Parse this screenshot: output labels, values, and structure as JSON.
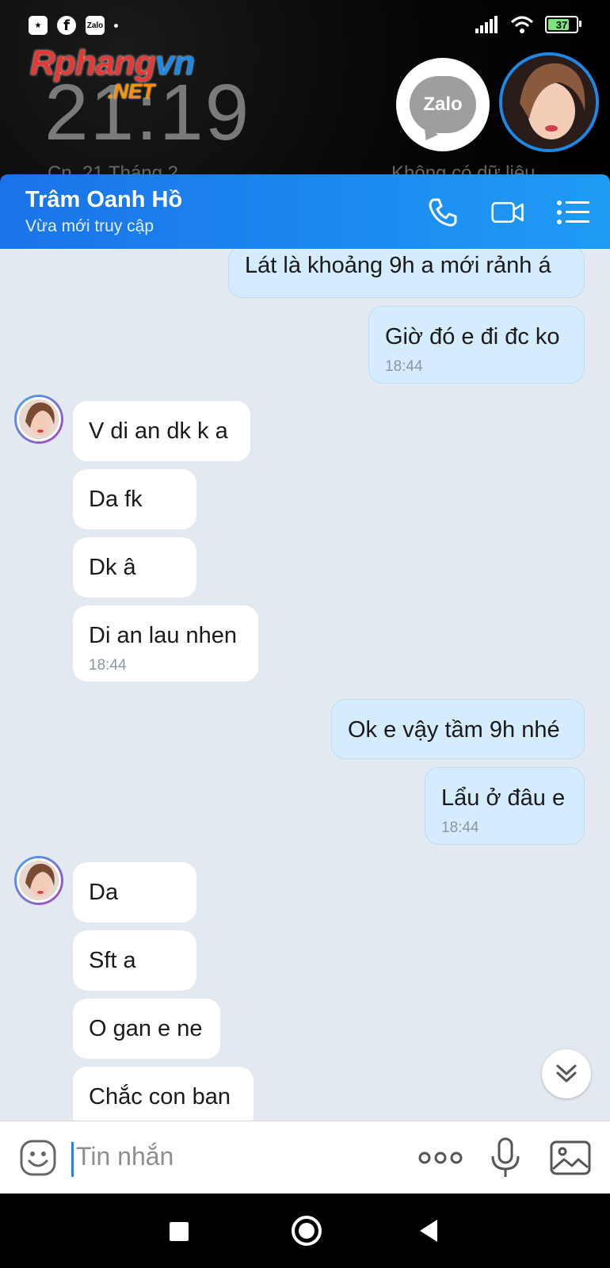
{
  "status_bar": {
    "battery": "37",
    "left_icons": [
      "star-app-icon",
      "facebook-icon",
      "zalo-icon"
    ],
    "zalo_small": "Zalo"
  },
  "lockscreen": {
    "watermark_a": "Rphang",
    "watermark_b": "vn",
    "watermark_net": ".NET",
    "time": "21:19",
    "date": "Cn, 21 Tháng 2",
    "no_data": "Không có dữ liệu"
  },
  "chat_head": {
    "app_label": "Zalo"
  },
  "header": {
    "contact_name": "Trâm Oanh Hồ",
    "status": "Vừa mới truy cập"
  },
  "messages": [
    {
      "dir": "out",
      "text": "Lát là khoảng 9h a mới rảnh á",
      "time": ""
    },
    {
      "dir": "out",
      "text": "Giờ đó e đi đc ko",
      "time": "18:44"
    },
    {
      "dir": "in",
      "text": "V di an dk k a",
      "time": ""
    },
    {
      "dir": "in",
      "text": "Da fk",
      "time": ""
    },
    {
      "dir": "in",
      "text": "Dk â",
      "time": ""
    },
    {
      "dir": "in",
      "text": "Di an lau nhen",
      "time": "18:44"
    },
    {
      "dir": "out",
      "text": "Ok e vậy tầm 9h nhé",
      "time": ""
    },
    {
      "dir": "out",
      "text": "Lẩu ở đâu e",
      "time": "18:44"
    },
    {
      "dir": "in",
      "text": "Da",
      "time": ""
    },
    {
      "dir": "in",
      "text": "Sft a",
      "time": ""
    },
    {
      "dir": "in",
      "text": "O gan e ne",
      "time": ""
    },
    {
      "dir": "in",
      "text": "Chắc con ban",
      "time": ""
    }
  ],
  "input": {
    "placeholder": "Tin nhắn"
  },
  "colors": {
    "header_start": "#1a73e8",
    "header_end": "#1e9bf5",
    "outgoing_bubble": "#d4ecfd",
    "incoming_bubble": "#ffffff",
    "chat_background": "#e2e9f1"
  }
}
